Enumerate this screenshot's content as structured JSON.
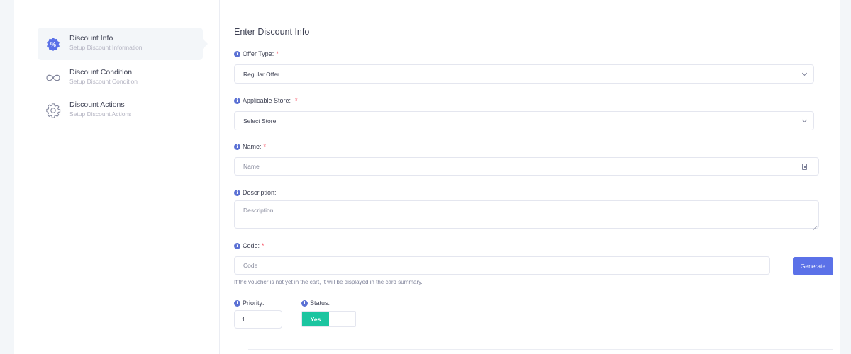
{
  "stepper": {
    "steps": [
      {
        "title": "Discount Info",
        "subtitle": "Setup Discount Information",
        "icon": "percent-badge-icon",
        "active": true
      },
      {
        "title": "Discount Condition",
        "subtitle": "Setup Discount Condition",
        "icon": "infinity-icon",
        "active": false
      },
      {
        "title": "Discount Actions",
        "subtitle": "Setup Discount Actions",
        "icon": "gear-icon",
        "active": false
      }
    ]
  },
  "form": {
    "title": "Enter Discount Info",
    "offer_type": {
      "label": "Offer Type:",
      "required": "*",
      "value": "Regular Offer"
    },
    "store": {
      "label": "Applicable Store:",
      "required": "*",
      "value": "Select Store"
    },
    "name": {
      "label": "Name:",
      "required": "*",
      "placeholder": "Name"
    },
    "description": {
      "label": "Description:",
      "placeholder": "Description"
    },
    "code": {
      "label": "Code:",
      "required": "*",
      "placeholder": "Code",
      "button": "Generate",
      "hint": "If the voucher is not yet in the cart, It will be displayed in the card summary."
    },
    "priority": {
      "label": "Priority:",
      "value": "1"
    },
    "status": {
      "label": "Status:",
      "value": "Yes"
    }
  },
  "colors": {
    "accent": "#5b71e8",
    "success": "#1bc5a0",
    "required": "#f64e60",
    "info": "#5b71d4"
  }
}
